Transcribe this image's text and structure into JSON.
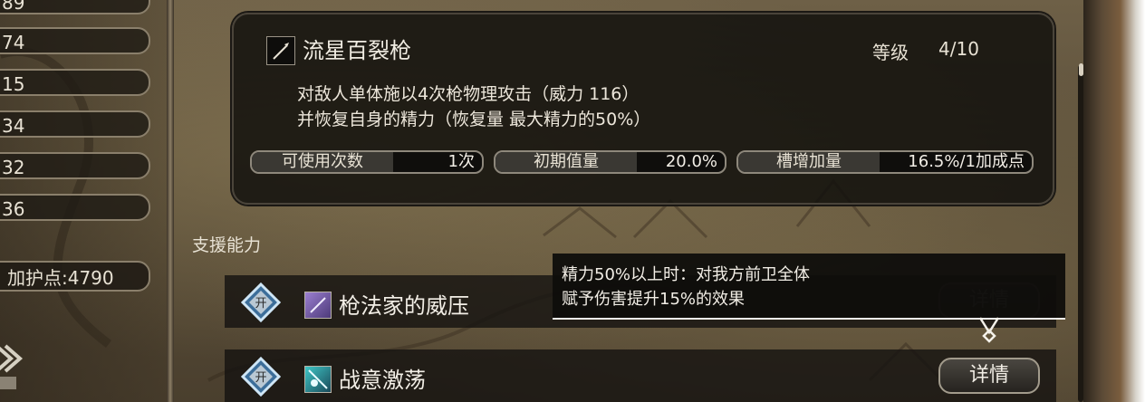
{
  "left_stats": [
    "89",
    "74",
    "15",
    "34",
    "32",
    "36"
  ],
  "bonus_points": "加护点:4790",
  "skill": {
    "name": "流星百裂枪",
    "level_label": "等级",
    "level_value": "4/10",
    "description_lines": [
      "对敌人单体施以4次枪物理攻击（威力 116）",
      "并恢复自身的精力（恢复量 最大精力的50%）"
    ],
    "params": [
      {
        "label": "可使用次数",
        "value": "1次"
      },
      {
        "label": "初期值量",
        "value": "20.0%"
      },
      {
        "label": "槽增加量",
        "value": "16.5%/1加成点"
      }
    ]
  },
  "support_title": "支援能力",
  "abilities": [
    {
      "badge": "开",
      "name": "枪法家的威压",
      "detail": "详情"
    },
    {
      "badge": "开",
      "name": "战意激荡",
      "detail": "详情"
    }
  ],
  "tooltip_lines": [
    "精力50%以上时：对我方前卫全体",
    "赋予伤害提升15%的效果"
  ],
  "icons": {
    "skill": "spear-icon",
    "ability1": "spear-aura-icon",
    "ability2": "spirit-burst-icon"
  }
}
